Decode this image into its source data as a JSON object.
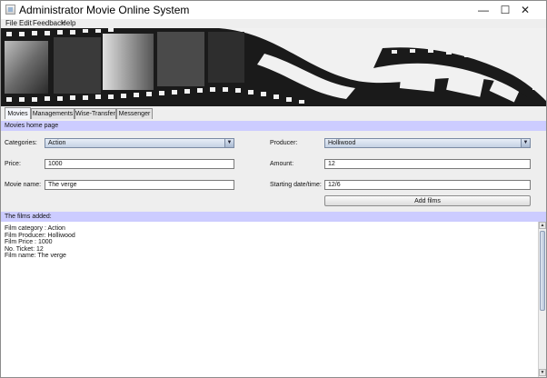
{
  "window": {
    "title": "Administrator Movie Online System",
    "controls": {
      "minimize": "—",
      "maximize": "☐",
      "close": "✕"
    }
  },
  "menu": {
    "items": [
      "File",
      "Edit",
      "Feedback",
      "Help"
    ]
  },
  "tabs": [
    {
      "label": "Movies",
      "active": true
    },
    {
      "label": "Managements",
      "active": false
    },
    {
      "label": "Wise-Transfer",
      "active": false
    },
    {
      "label": "Messenger",
      "active": false
    }
  ],
  "movies_header": "Movies home page",
  "form": {
    "categories_label": "Categories:",
    "categories_value": "Action",
    "producer_label": "Producer:",
    "producer_value": "Holliwood",
    "price_label": "Price:",
    "price_value": "1000",
    "amount_label": "Amount:",
    "amount_value": "12",
    "movie_name_label": "Movie name:",
    "movie_name_value": "The verge",
    "starting_label": "Starting date/time:",
    "starting_value": "12/6",
    "add_button": "Add films"
  },
  "films_header": "The films added:",
  "films_output": [
    "Film category : Action",
    "Film Producer: Holliwood",
    "Film Price : 1000",
    "No. Ticket: 12",
    "Film name: The verge"
  ],
  "colors": {
    "section_header": "#ccccff",
    "window_bg": "#eeeeee"
  }
}
